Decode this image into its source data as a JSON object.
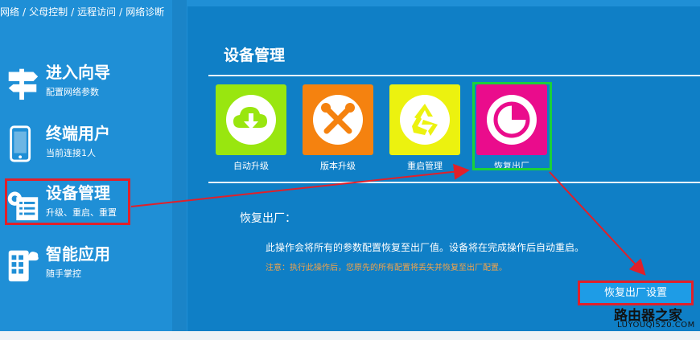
{
  "breadcrumb": [
    "网络",
    "父母控制",
    "远程访问",
    "网络诊断"
  ],
  "sidebar": {
    "items": [
      {
        "title": "进入向导",
        "sub": "配置网络参数",
        "icon": "signpost-icon"
      },
      {
        "title": "终端用户",
        "sub": "当前连接1人",
        "icon": "phone-icon"
      },
      {
        "title": "设备管理",
        "sub": "升级、重启、重置",
        "icon": "device-settings-icon"
      },
      {
        "title": "智能应用",
        "sub": "随手掌控",
        "icon": "smart-app-icon"
      }
    ]
  },
  "main": {
    "title": "设备管理",
    "tiles": [
      {
        "label": "自动升级",
        "color": "#99e60f",
        "icon": "cloud-download-icon"
      },
      {
        "label": "版本升级",
        "color": "#f5820f",
        "icon": "tools-icon"
      },
      {
        "label": "重启管理",
        "color": "#ecf20f",
        "icon": "recycle-icon"
      },
      {
        "label": "恢复出厂",
        "color": "#ea0c8c",
        "icon": "pie-chart-icon"
      }
    ],
    "section_label": "恢复出厂：",
    "description": "此操作会将所有的参数配置恢复至出厂值。设备将在完成操作后自动重启。",
    "note": "注意：执行此操作后，您原先的所有配置将丢失并恢复至出厂配置。",
    "reset_button": "恢复出厂设置"
  },
  "watermark": {
    "main": "路由器之家",
    "sub": "LUYOUQI520.COM"
  },
  "colors": {
    "background": "#1f8fd6",
    "panel": "#0f7fc6",
    "highlight": "#e0202a",
    "selection": "#19d13a",
    "note": "#f2a34a"
  }
}
